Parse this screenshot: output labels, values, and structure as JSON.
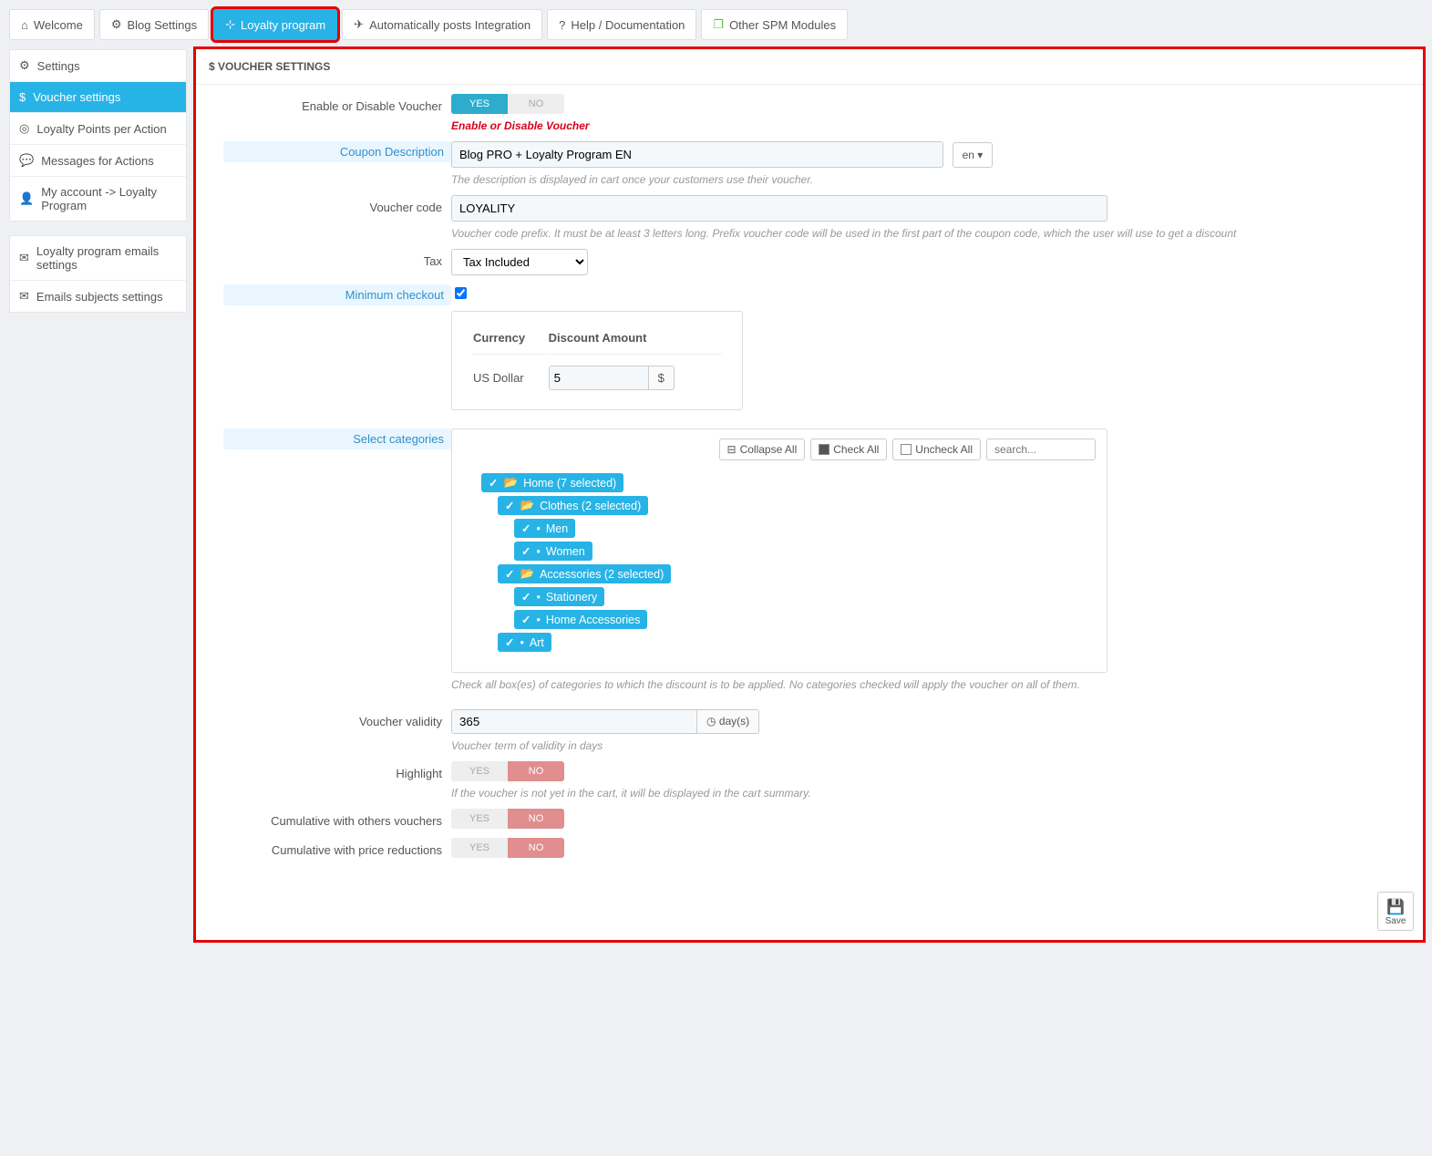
{
  "tabs": [
    {
      "icon": "home-icon",
      "glyph": "⌂",
      "label": "Welcome"
    },
    {
      "icon": "gears-icon",
      "glyph": "⚙",
      "label": "Blog Settings"
    },
    {
      "icon": "sitemap-icon",
      "glyph": "⊹",
      "label": "Loyalty program",
      "active": true
    },
    {
      "icon": "send-icon",
      "glyph": "✈",
      "label": "Automatically posts Integration"
    },
    {
      "icon": "help-icon",
      "glyph": "?",
      "label": "Help / Documentation"
    },
    {
      "icon": "modules-icon",
      "glyph": "❐",
      "label": "Other SPM Modules",
      "glyphColor": "#5fbf3f"
    }
  ],
  "sidebarA": [
    {
      "icon": "gears-icon",
      "glyph": "⚙",
      "label": "Settings"
    },
    {
      "icon": "dollar-icon",
      "glyph": "$",
      "label": "Voucher settings",
      "active": true
    },
    {
      "icon": "target-icon",
      "glyph": "◎",
      "label": "Loyalty Points per Action"
    },
    {
      "icon": "comment-icon",
      "glyph": "💬",
      "label": "Messages for Actions"
    },
    {
      "icon": "user-icon",
      "glyph": "👤",
      "label": "My account -> Loyalty Program"
    }
  ],
  "sidebarB": [
    {
      "icon": "mail-icon",
      "glyph": "✉",
      "label": "Loyalty program emails settings"
    },
    {
      "icon": "mail-icon",
      "glyph": "✉",
      "label": "Emails subjects settings"
    }
  ],
  "panel_title": "$ VOUCHER SETTINGS",
  "f": {
    "enable_label": "Enable or Disable Voucher",
    "enable_yes": "YES",
    "enable_no": "NO",
    "enable_hint": "Enable or Disable Voucher",
    "coupon_label": "Coupon Description",
    "coupon_value": "Blog PRO + Loyalty Program EN",
    "lang": "en ▾",
    "coupon_hint": "The description is displayed in cart once your customers use their voucher.",
    "code_label": "Voucher code",
    "code_value": "LOYALITY",
    "code_hint": "Voucher code prefix. It must be at least 3 letters long. Prefix voucher code will be used in the first part of the coupon code, which the user will use to get a discount",
    "tax_label": "Tax",
    "tax_value": "Tax Included",
    "min_label": "Minimum checkout",
    "currency_h1": "Currency",
    "currency_h2": "Discount Amount",
    "currency_name": "US Dollar",
    "currency_amt": "5",
    "currency_sym": "$",
    "cats_label": "Select categories",
    "collapse": "Collapse All",
    "check": "Check All",
    "uncheck": "Uncheck All",
    "search_ph": "search...",
    "tree": [
      {
        "lvl": 0,
        "folder": true,
        "label": "Home (7 selected)"
      },
      {
        "lvl": 1,
        "folder": true,
        "label": "Clothes (2 selected)"
      },
      {
        "lvl": 2,
        "folder": false,
        "label": "Men"
      },
      {
        "lvl": 2,
        "folder": false,
        "label": "Women"
      },
      {
        "lvl": 1,
        "folder": true,
        "label": "Accessories (2 selected)"
      },
      {
        "lvl": 2,
        "folder": false,
        "label": "Stationery"
      },
      {
        "lvl": 2,
        "folder": false,
        "label": "Home Accessories"
      },
      {
        "lvl": 1,
        "folder": false,
        "label": "Art"
      }
    ],
    "cats_hint": "Check all box(es) of categories to which the discount is to be applied. No categories checked will apply the voucher on all of them.",
    "valid_label": "Voucher validity",
    "valid_value": "365",
    "valid_unit": "day(s)",
    "valid_hint": "Voucher term of validity in days",
    "hl_label": "Highlight",
    "hl_yes": "YES",
    "hl_no": "NO",
    "hl_hint": "If the voucher is not yet in the cart, it will be displayed in the cart summary.",
    "cum1_label": "Cumulative with others vouchers",
    "cum2_label": "Cumulative with price reductions",
    "save": "Save"
  }
}
